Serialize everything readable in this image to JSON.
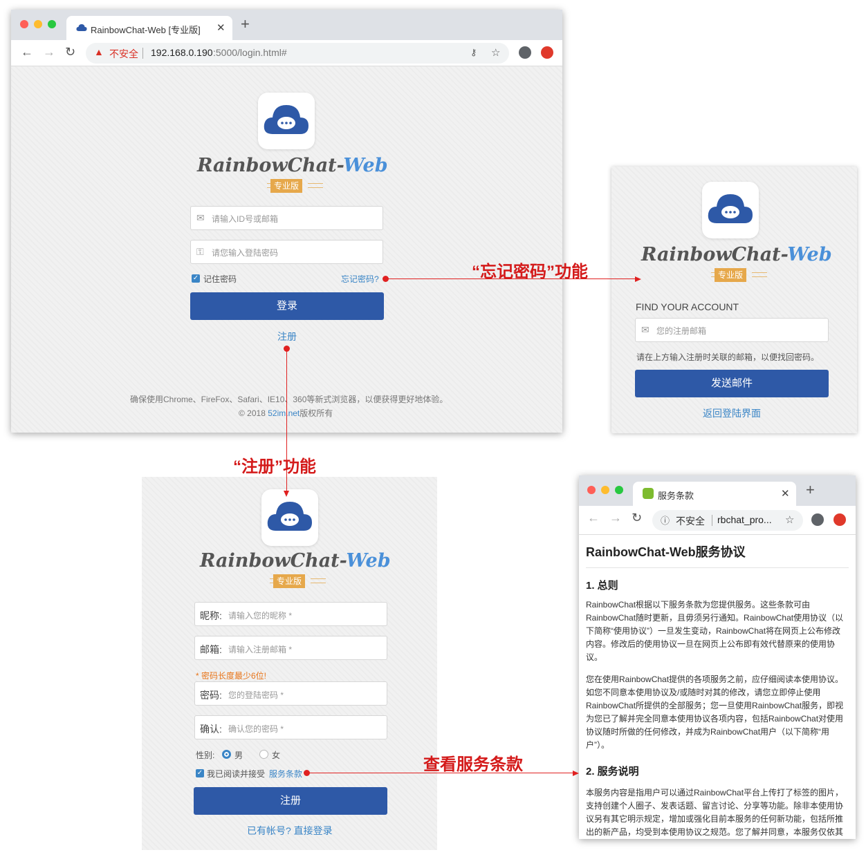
{
  "login_window": {
    "tab_title": "RainbowChat-Web [专业版]",
    "url_warning": "不安全",
    "url_host": "192.168.0.190",
    "url_rest": ":5000/login.html#",
    "brand_main": "RainbowChat",
    "brand_dash": "-",
    "brand_web": "Web",
    "edition": "专业版",
    "id_placeholder": "请输入ID号或邮箱",
    "password_placeholder": "请您输入登陆密码",
    "remember_label": "记住密码",
    "forgot_link": "忘记密码?",
    "login_button": "登录",
    "register_link": "注册",
    "footer_line1": "确保使用Chrome、FireFox、Safari、IE10、360等新式浏览器，以便获得更好地体验。",
    "footer_line2_pre": "© 2018 ",
    "footer_line2_link": "52im.net",
    "footer_line2_post": "版权所有"
  },
  "annotations": {
    "forgot_feature": "“忘记密码”功能",
    "register_feature": "“注册”功能",
    "terms_feature": "查看服务条款"
  },
  "find_account": {
    "brand_main": "RainbowChat",
    "brand_dash": "-",
    "brand_web": "Web",
    "edition": "专业版",
    "heading": "FIND YOUR ACCOUNT",
    "email_placeholder": "您的注册邮箱",
    "hint": "请在上方输入注册时关联的邮箱，以便找回密码。",
    "send_button": "发送邮件",
    "back_link": "返回登陆界面"
  },
  "register": {
    "brand_main": "RainbowChat",
    "brand_dash": "-",
    "brand_web": "Web",
    "edition": "专业版",
    "nickname_label": "昵称:",
    "nickname_placeholder": "请输入您的昵称 *",
    "email_label": "邮箱:",
    "email_placeholder": "请输入注册邮箱 *",
    "password_hint": "* 密码长度最少6位!",
    "password_label": "密码:",
    "password_placeholder": "您的登陆密码 *",
    "confirm_label": "确认:",
    "confirm_placeholder": "确认您的密码 *",
    "gender_label": "性别:",
    "gender_male": "男",
    "gender_female": "女",
    "agree_label": "我已阅读并接受",
    "terms_link": "服务条款",
    "register_button": "注册",
    "login_link": "已有帐号? 直接登录"
  },
  "terms_window": {
    "tab_title": "服务条款",
    "url_warning": "不安全",
    "url_text": "rbchat_pro...",
    "title": "RainbowChat-Web服务协议",
    "section1_title": "1. 总则",
    "section1_p1": "RainbowChat根据以下服务条款为您提供服务。这些条款可由RainbowChat随时更新，且毋须另行通知。RainbowChat使用协议（以下简称“使用协议”）一旦发生变动，RainbowChat将在网页上公布修改内容。修改后的使用协议一旦在网页上公布即有效代替原来的使用协议。",
    "section1_p2": "您在使用RainbowChat提供的各项服务之前，应仔细阅读本使用协议。如您不同意本使用协议及/或随时对其的修改，请您立即停止使用RainbowChat所提供的全部服务；您一旦使用RainbowChat服务，即视为您已了解并完全同意本使用协议各项内容，包括RainbowChat对使用协议随时所做的任何修改，并成为RainbowChat用户（以下简称“用户”）。",
    "section2_title": "2. 服务说明",
    "section2_p1": "本服务内容是指用户可以通过RainbowChat平台上传打了标签的图片，支持创建个人圈子、发表话题、留言讨论、分享等功能。除非本使用协议另有其它明示规定，增加或强化目前本服务的任何新功能，包括所推出的新产品，均受到本使用协议之规范。您了解并同意，本服务仅依其"
  },
  "colors": {
    "primary_button": "#2e59a7",
    "link": "#3a85c6",
    "annotation_red": "#d41a1a",
    "edition_ribbon": "#e6a84b"
  }
}
